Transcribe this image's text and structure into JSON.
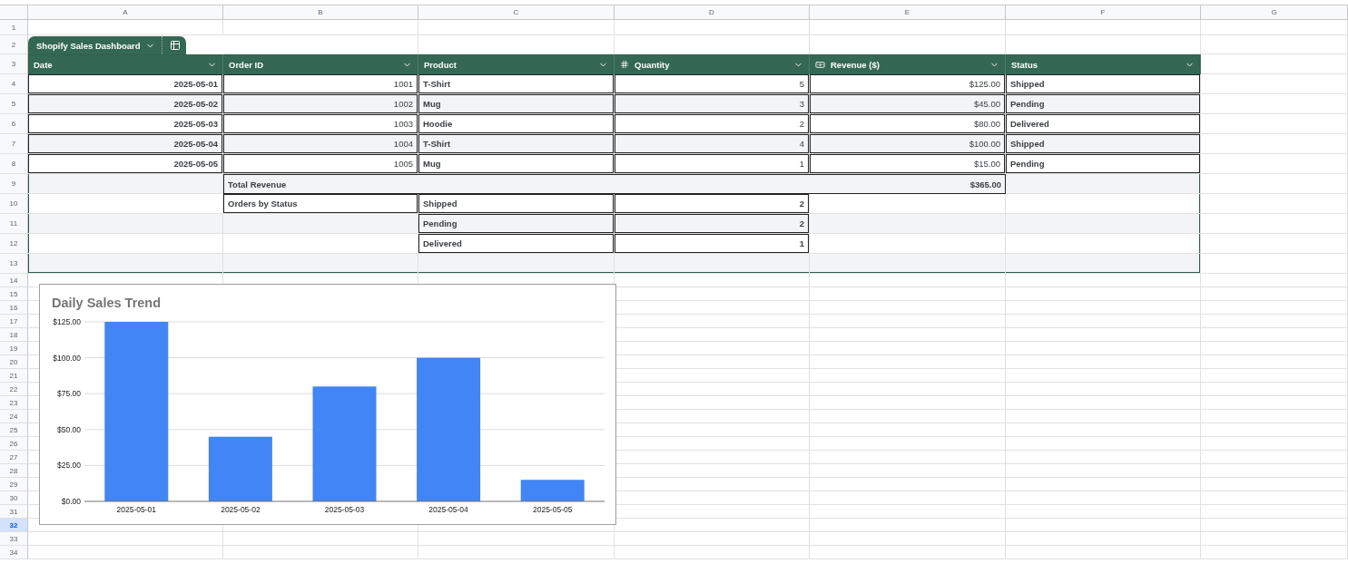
{
  "column_headers": [
    "A",
    "B",
    "C",
    "D",
    "E",
    "F",
    "G"
  ],
  "row_numbers": [
    {
      "label": "1",
      "selected": false
    },
    {
      "label": "2",
      "selected": false
    },
    {
      "label": "3",
      "selected": false
    },
    {
      "label": "4",
      "selected": false
    },
    {
      "label": "5",
      "selected": false
    },
    {
      "label": "6",
      "selected": false
    },
    {
      "label": "7",
      "selected": false
    },
    {
      "label": "8",
      "selected": false
    },
    {
      "label": "9",
      "selected": false
    },
    {
      "label": "10",
      "selected": false
    },
    {
      "label": "11",
      "selected": false
    },
    {
      "label": "12",
      "selected": false
    },
    {
      "label": "13",
      "selected": false
    },
    {
      "label": "14",
      "selected": false
    },
    {
      "label": "15",
      "selected": false
    },
    {
      "label": "16",
      "selected": false
    },
    {
      "label": "17",
      "selected": false
    },
    {
      "label": "18",
      "selected": false
    },
    {
      "label": "19",
      "selected": false
    },
    {
      "label": "20",
      "selected": false
    },
    {
      "label": "21",
      "selected": false
    },
    {
      "label": "22",
      "selected": false
    },
    {
      "label": "23",
      "selected": false
    },
    {
      "label": "24",
      "selected": false
    },
    {
      "label": "25",
      "selected": false
    },
    {
      "label": "26",
      "selected": false
    },
    {
      "label": "27",
      "selected": false
    },
    {
      "label": "28",
      "selected": false
    },
    {
      "label": "29",
      "selected": false
    },
    {
      "label": "30",
      "selected": false
    },
    {
      "label": "31",
      "selected": false
    },
    {
      "label": "32",
      "selected": true
    },
    {
      "label": "33",
      "selected": false
    },
    {
      "label": "34",
      "selected": false
    }
  ],
  "table": {
    "name": "Shopify Sales Dashboard",
    "columns": [
      {
        "label": "Date",
        "kind": "date"
      },
      {
        "label": "Order ID",
        "kind": "id"
      },
      {
        "label": "Product",
        "kind": "text"
      },
      {
        "label": "Quantity",
        "kind": "number"
      },
      {
        "label": "Revenue ($)",
        "kind": "currency"
      },
      {
        "label": "Status",
        "kind": "status"
      }
    ],
    "rows": [
      [
        "2025-05-01",
        "1001",
        "T-Shirt",
        "5",
        "$125.00",
        "Shipped"
      ],
      [
        "2025-05-02",
        "1002",
        "Mug",
        "3",
        "$45.00",
        "Pending"
      ],
      [
        "2025-05-03",
        "1003",
        "Hoodie",
        "2",
        "$80.00",
        "Delivered"
      ],
      [
        "2025-05-04",
        "1004",
        "T-Shirt",
        "4",
        "$100.00",
        "Shipped"
      ],
      [
        "2025-05-05",
        "1005",
        "Mug",
        "1",
        "$15.00",
        "Pending"
      ]
    ],
    "total": {
      "label": "Total Revenue",
      "value": "$365.00"
    },
    "status_summary": {
      "label": "Orders by Status",
      "items": [
        {
          "status": "Shipped",
          "count": "2"
        },
        {
          "status": "Pending",
          "count": "2"
        },
        {
          "status": "Delivered",
          "count": "1"
        }
      ]
    }
  },
  "chart": {
    "chart_data": {
      "type": "bar",
      "grid": true,
      "title": "Daily Sales Trend",
      "categories": [
        "2025-05-01",
        "2025-05-02",
        "2025-05-03",
        "2025-05-04",
        "2025-05-05"
      ],
      "values": [
        125,
        45,
        80,
        100,
        15
      ],
      "ylim": [
        0,
        125
      ],
      "yticks": [
        {
          "value": 0,
          "label": "$0.00"
        },
        {
          "value": 25,
          "label": "$25.00"
        },
        {
          "value": 50,
          "label": "$50.00"
        },
        {
          "value": 75,
          "label": "$75.00"
        },
        {
          "value": 100,
          "label": "$100.00"
        },
        {
          "value": 125,
          "label": "$125.00"
        }
      ]
    }
  }
}
